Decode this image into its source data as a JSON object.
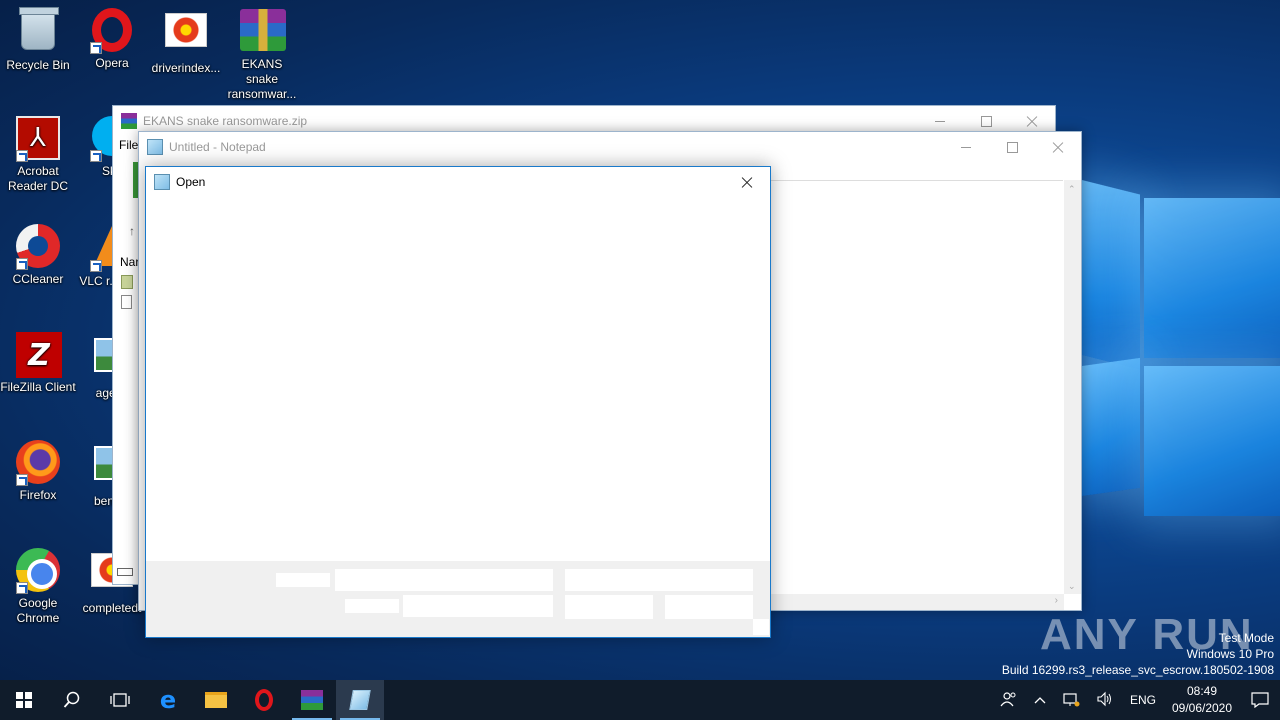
{
  "desktop": {
    "icons": [
      {
        "label": "Recycle Bin",
        "icon": "recycle-bin-icon"
      },
      {
        "label": "Opera",
        "icon": "opera-icon"
      },
      {
        "label": "driverindex...",
        "icon": "image-file-icon"
      },
      {
        "label": "EKANS snake ransomwar...",
        "icon": "winrar-archive-icon"
      },
      {
        "label": "Acrobat Reader DC",
        "icon": "acrobat-icon"
      },
      {
        "label": "Sky",
        "icon": "skype-icon"
      },
      {
        "label": "CCleaner",
        "icon": "ccleaner-icon"
      },
      {
        "label": "VLC r... play",
        "icon": "vlc-icon"
      },
      {
        "label": "FileZilla Client",
        "icon": "filezilla-icon"
      },
      {
        "label": "agenc",
        "icon": "image-file-icon"
      },
      {
        "label": "Firefox",
        "icon": "firefox-icon"
      },
      {
        "label": "benefit",
        "icon": "image-file-icon"
      },
      {
        "label": "Google Chrome",
        "icon": "chrome-icon"
      },
      {
        "label": "completedt",
        "icon": "image-file-icon"
      }
    ]
  },
  "winrar_window": {
    "title": "EKANS snake ransomware.zip",
    "menu_file": "File",
    "column_name": "Nar"
  },
  "notepad_window": {
    "title": "Untitled - Notepad"
  },
  "open_dialog": {
    "title": "Open"
  },
  "taskbar": {
    "language": "ENG",
    "time": "08:49",
    "date": "09/06/2020"
  },
  "watermark": {
    "brand": "ANY RUN",
    "line1": "Test Mode",
    "line2": "Windows 10 Pro",
    "line3": "Build 16299.rs3_release_svc_escrow.180502-1908"
  },
  "colors": {
    "accent": "#1979ca",
    "taskbar": "#101c2b",
    "desktop": "#0a3a7c"
  }
}
